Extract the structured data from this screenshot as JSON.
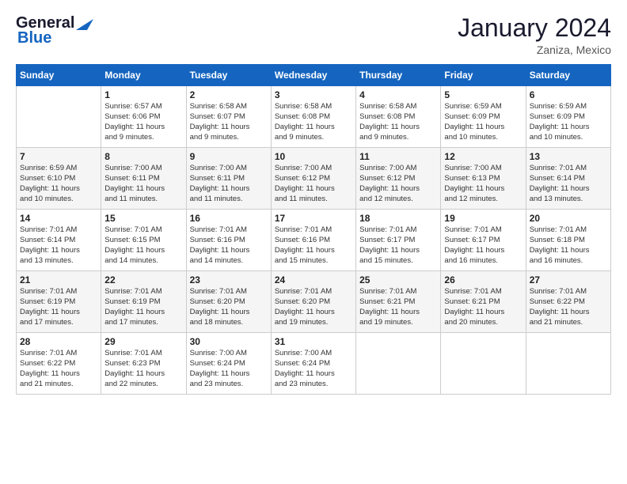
{
  "logo": {
    "line1": "General",
    "line2": "Blue"
  },
  "title": "January 2024",
  "subtitle": "Zaniza, Mexico",
  "days_header": [
    "Sunday",
    "Monday",
    "Tuesday",
    "Wednesday",
    "Thursday",
    "Friday",
    "Saturday"
  ],
  "weeks": [
    [
      {
        "day": "",
        "content": ""
      },
      {
        "day": "1",
        "content": "Sunrise: 6:57 AM\nSunset: 6:06 PM\nDaylight: 11 hours\nand 9 minutes."
      },
      {
        "day": "2",
        "content": "Sunrise: 6:58 AM\nSunset: 6:07 PM\nDaylight: 11 hours\nand 9 minutes."
      },
      {
        "day": "3",
        "content": "Sunrise: 6:58 AM\nSunset: 6:08 PM\nDaylight: 11 hours\nand 9 minutes."
      },
      {
        "day": "4",
        "content": "Sunrise: 6:58 AM\nSunset: 6:08 PM\nDaylight: 11 hours\nand 9 minutes."
      },
      {
        "day": "5",
        "content": "Sunrise: 6:59 AM\nSunset: 6:09 PM\nDaylight: 11 hours\nand 10 minutes."
      },
      {
        "day": "6",
        "content": "Sunrise: 6:59 AM\nSunset: 6:09 PM\nDaylight: 11 hours\nand 10 minutes."
      }
    ],
    [
      {
        "day": "7",
        "content": "Sunrise: 6:59 AM\nSunset: 6:10 PM\nDaylight: 11 hours\nand 10 minutes."
      },
      {
        "day": "8",
        "content": "Sunrise: 7:00 AM\nSunset: 6:11 PM\nDaylight: 11 hours\nand 11 minutes."
      },
      {
        "day": "9",
        "content": "Sunrise: 7:00 AM\nSunset: 6:11 PM\nDaylight: 11 hours\nand 11 minutes."
      },
      {
        "day": "10",
        "content": "Sunrise: 7:00 AM\nSunset: 6:12 PM\nDaylight: 11 hours\nand 11 minutes."
      },
      {
        "day": "11",
        "content": "Sunrise: 7:00 AM\nSunset: 6:12 PM\nDaylight: 11 hours\nand 12 minutes."
      },
      {
        "day": "12",
        "content": "Sunrise: 7:00 AM\nSunset: 6:13 PM\nDaylight: 11 hours\nand 12 minutes."
      },
      {
        "day": "13",
        "content": "Sunrise: 7:01 AM\nSunset: 6:14 PM\nDaylight: 11 hours\nand 13 minutes."
      }
    ],
    [
      {
        "day": "14",
        "content": "Sunrise: 7:01 AM\nSunset: 6:14 PM\nDaylight: 11 hours\nand 13 minutes."
      },
      {
        "day": "15",
        "content": "Sunrise: 7:01 AM\nSunset: 6:15 PM\nDaylight: 11 hours\nand 14 minutes."
      },
      {
        "day": "16",
        "content": "Sunrise: 7:01 AM\nSunset: 6:16 PM\nDaylight: 11 hours\nand 14 minutes."
      },
      {
        "day": "17",
        "content": "Sunrise: 7:01 AM\nSunset: 6:16 PM\nDaylight: 11 hours\nand 15 minutes."
      },
      {
        "day": "18",
        "content": "Sunrise: 7:01 AM\nSunset: 6:17 PM\nDaylight: 11 hours\nand 15 minutes."
      },
      {
        "day": "19",
        "content": "Sunrise: 7:01 AM\nSunset: 6:17 PM\nDaylight: 11 hours\nand 16 minutes."
      },
      {
        "day": "20",
        "content": "Sunrise: 7:01 AM\nSunset: 6:18 PM\nDaylight: 11 hours\nand 16 minutes."
      }
    ],
    [
      {
        "day": "21",
        "content": "Sunrise: 7:01 AM\nSunset: 6:19 PM\nDaylight: 11 hours\nand 17 minutes."
      },
      {
        "day": "22",
        "content": "Sunrise: 7:01 AM\nSunset: 6:19 PM\nDaylight: 11 hours\nand 17 minutes."
      },
      {
        "day": "23",
        "content": "Sunrise: 7:01 AM\nSunset: 6:20 PM\nDaylight: 11 hours\nand 18 minutes."
      },
      {
        "day": "24",
        "content": "Sunrise: 7:01 AM\nSunset: 6:20 PM\nDaylight: 11 hours\nand 19 minutes."
      },
      {
        "day": "25",
        "content": "Sunrise: 7:01 AM\nSunset: 6:21 PM\nDaylight: 11 hours\nand 19 minutes."
      },
      {
        "day": "26",
        "content": "Sunrise: 7:01 AM\nSunset: 6:21 PM\nDaylight: 11 hours\nand 20 minutes."
      },
      {
        "day": "27",
        "content": "Sunrise: 7:01 AM\nSunset: 6:22 PM\nDaylight: 11 hours\nand 21 minutes."
      }
    ],
    [
      {
        "day": "28",
        "content": "Sunrise: 7:01 AM\nSunset: 6:22 PM\nDaylight: 11 hours\nand 21 minutes."
      },
      {
        "day": "29",
        "content": "Sunrise: 7:01 AM\nSunset: 6:23 PM\nDaylight: 11 hours\nand 22 minutes."
      },
      {
        "day": "30",
        "content": "Sunrise: 7:00 AM\nSunset: 6:24 PM\nDaylight: 11 hours\nand 23 minutes."
      },
      {
        "day": "31",
        "content": "Sunrise: 7:00 AM\nSunset: 6:24 PM\nDaylight: 11 hours\nand 23 minutes."
      },
      {
        "day": "",
        "content": ""
      },
      {
        "day": "",
        "content": ""
      },
      {
        "day": "",
        "content": ""
      }
    ]
  ]
}
